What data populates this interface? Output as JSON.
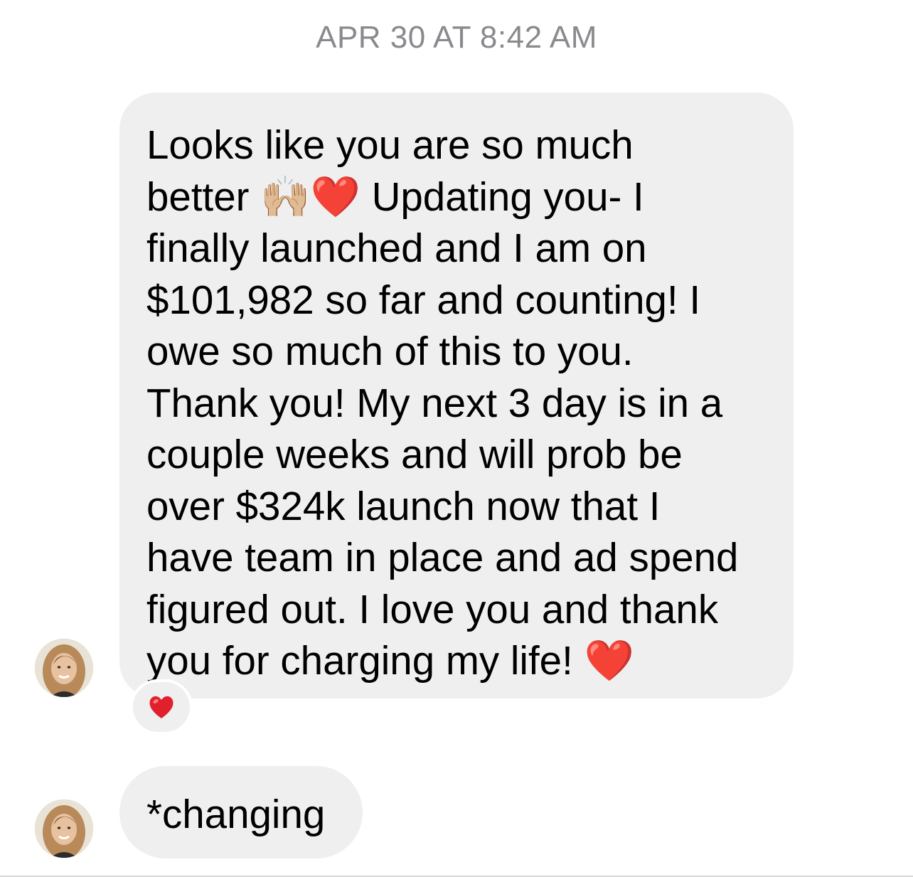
{
  "thread": {
    "timestamp": "APR 30 AT 8:42 AM"
  },
  "messages": [
    {
      "sender": "contact",
      "text": "Looks like you are so much\nbetter 🙌🏼❤️ Updating you- I\nfinally launched and I am on\n$101,982 so far and counting! I\nowe so much of this to you.\nThank you! My next 3 day is in a\ncouple weeks and will prob be\nover $324k launch now that I\nhave team in place and ad spend\nfigured out. I love you and thank\nyou for charging my life! ❤️",
      "reaction": "❤️"
    },
    {
      "sender": "contact",
      "text": "*changing"
    }
  ],
  "icons": {
    "avatar": "avatar-photo",
    "reaction": "heart-icon"
  },
  "colors": {
    "bubble": "#efefef",
    "timestamp": "#8a8a8e",
    "heart": "#e0202c"
  }
}
